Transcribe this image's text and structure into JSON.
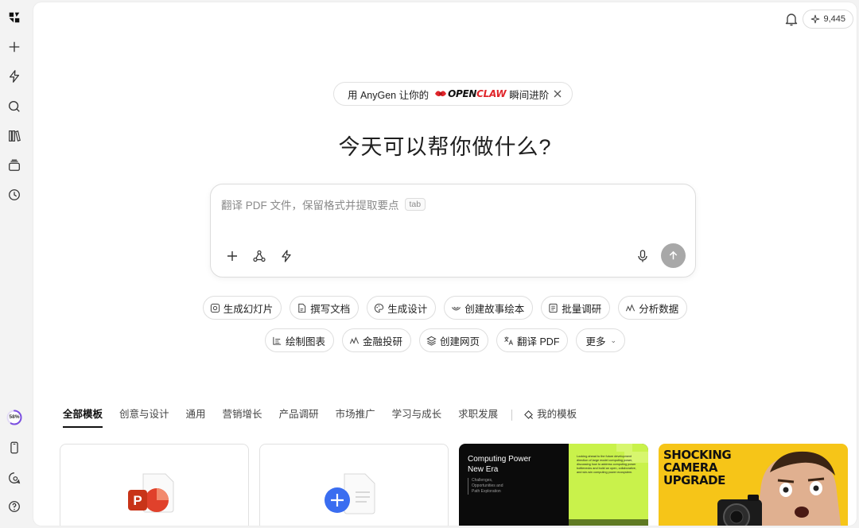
{
  "header": {
    "credits": "9,445"
  },
  "promo": {
    "prefix": "用 AnyGen 让你的",
    "brand_part1": "OPEN",
    "brand_part2": "CLAW",
    "suffix": "瞬间进阶"
  },
  "headline": "今天可以帮你做什么?",
  "composer": {
    "placeholder": "翻译 PDF 文件，保留格式并提取要点",
    "tab_hint": "tab"
  },
  "quick_actions_row1": [
    "生成幻灯片",
    "撰写文档",
    "生成设计",
    "创建故事绘本",
    "批量调研",
    "分析数据"
  ],
  "quick_actions_row2": [
    "绘制图表",
    "金融投研",
    "创建网页",
    "翻译 PDF",
    "更多"
  ],
  "sidebar": {
    "progress": "58%",
    "progress_value": 0.58
  },
  "template_tabs": [
    "全部模板",
    "创意与设计",
    "通用",
    "营销增长",
    "产品调研",
    "市场推广",
    "学习与成长",
    "求职发展"
  ],
  "my_templates_label": "我的模板",
  "cards": {
    "card3": {
      "title_line1": "Computing Power",
      "title_line2": "New Era",
      "sub_line1": "Challenges,",
      "sub_line2": "Opportunities and",
      "sub_line3": "Path Exploration",
      "right_text": "Looking ahead to the future development direction of large model computing power, discussing how to address computing power bottlenecks and build an open, collaborative, and win-win computing power ecosystem."
    },
    "card4": {
      "line1": "SHOCKING",
      "line2": "CAMERA",
      "line3": "UPGRADE"
    }
  },
  "colors": {
    "accent_blue": "#3a6df0",
    "ppt_red": "#e0412b",
    "lime": "#c9f24b",
    "yellow": "#f6c518",
    "progress_purple": "#7b4fe0"
  }
}
